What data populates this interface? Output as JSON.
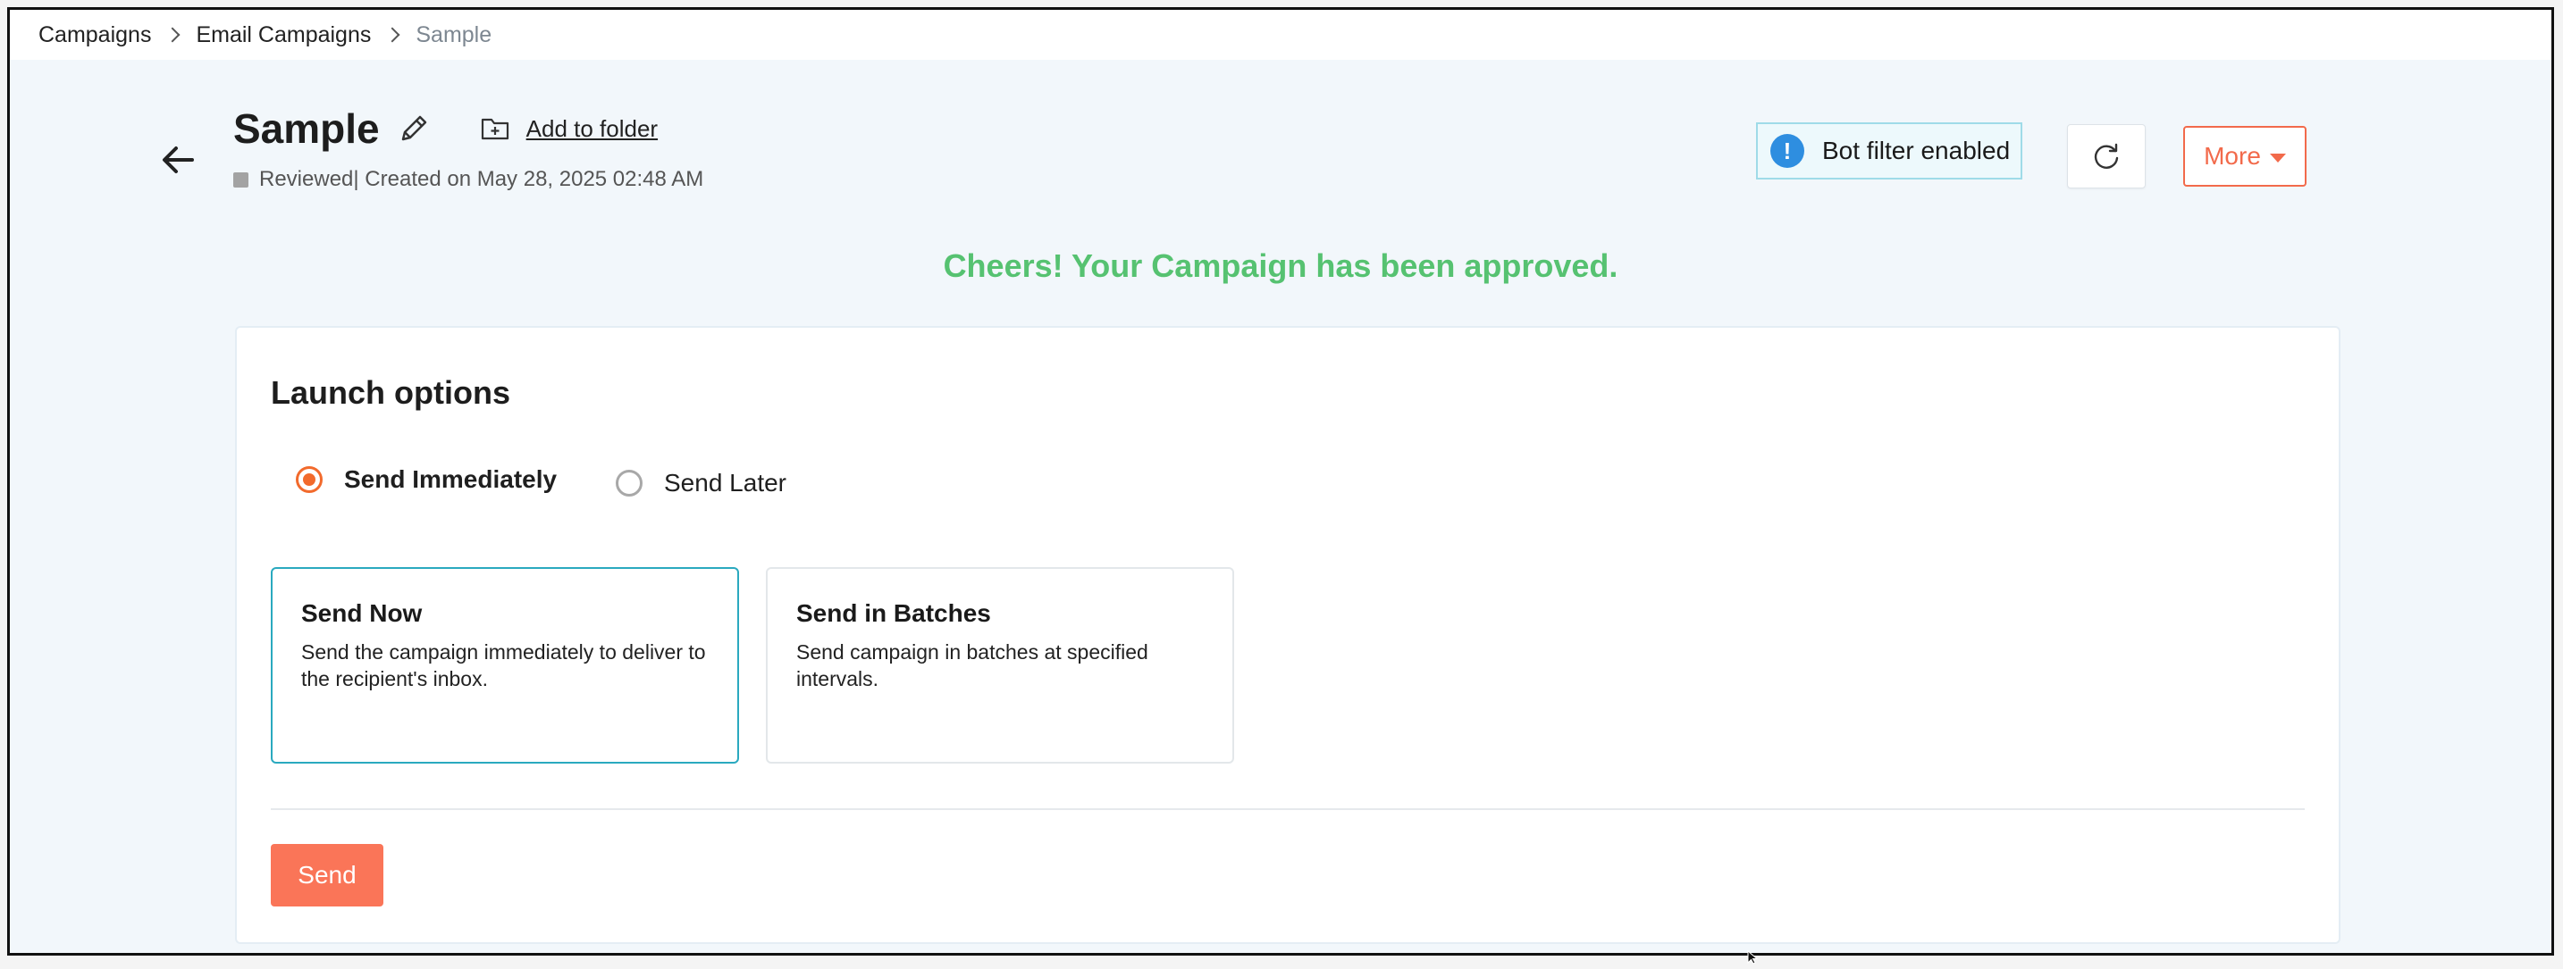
{
  "breadcrumb": {
    "items": [
      "Campaigns",
      "Email Campaigns",
      "Sample"
    ]
  },
  "header": {
    "title": "Sample",
    "add_to_folder": "Add to folder",
    "status_label": "Reviewed",
    "created_text": " | Created on May 28, 2025 02:48 AM",
    "bot_filter_label": "Bot filter enabled",
    "info_glyph": "!",
    "more_label": "More"
  },
  "approval_message": "Cheers! Your Campaign has been approved.",
  "launch": {
    "title": "Launch options",
    "radio_options": [
      {
        "label": "Send Immediately",
        "checked": true
      },
      {
        "label": "Send Later",
        "checked": false
      }
    ],
    "options": [
      {
        "title": "Send Now",
        "description": "Send the campaign immediately to deliver to the recipient's inbox.",
        "selected": true
      },
      {
        "title": "Send in Batches",
        "description": "Send campaign in batches at specified intervals.",
        "selected": false
      }
    ],
    "send_label": "Send"
  },
  "colors": {
    "accent_orange": "#f26a4b",
    "send_button": "#fa7558",
    "success_green": "#56c271",
    "selected_border": "#2aa9bf",
    "info_blue": "#2e8ee0"
  },
  "icons": {
    "back": "arrow-left-icon",
    "edit": "pencil-icon",
    "folder": "folder-plus-icon",
    "info": "info-icon",
    "refresh": "refresh-icon",
    "caret": "caret-down-icon"
  }
}
